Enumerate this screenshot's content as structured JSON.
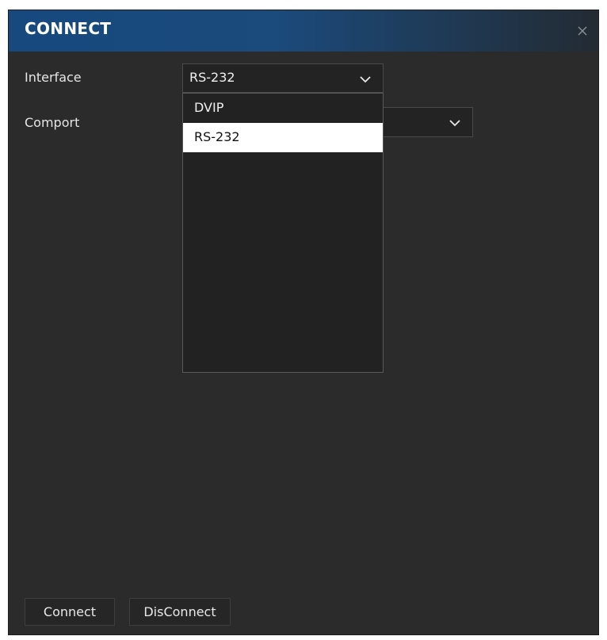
{
  "window": {
    "title": "CONNECT",
    "close_icon": "close-icon"
  },
  "form": {
    "interface_label": "Interface",
    "interface_value": "RS-232",
    "comport_label": "Comport",
    "comport_value": ""
  },
  "dropdown": {
    "options": [
      {
        "label": "DVIP",
        "selected": false
      },
      {
        "label": "RS-232",
        "selected": true
      }
    ]
  },
  "buttons": {
    "connect": "Connect",
    "disconnect": "DisConnect"
  },
  "colors": {
    "title_bar_start": "#17497e",
    "title_bar_end": "#232b33",
    "panel_bg": "#2b2b2b",
    "selected_option_bg": "#ffffff"
  }
}
